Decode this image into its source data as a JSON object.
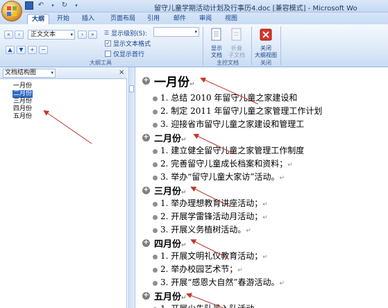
{
  "title": "留守儿童学期活动计划及行事历4.doc [兼容模式] - Microsoft Wo",
  "tabs": [
    {
      "label": "大纲",
      "active": true
    },
    {
      "label": "开始"
    },
    {
      "label": "插入"
    },
    {
      "label": "页面布局"
    },
    {
      "label": "引用"
    },
    {
      "label": "邮件"
    },
    {
      "label": "审阅"
    },
    {
      "label": "视图"
    }
  ],
  "ribbon": {
    "level_select": "正文文本",
    "show_level_label": "显示级别(S):",
    "show_text_format": "显示文本格式",
    "show_first_line": "仅显示首行",
    "outline_tools_label": "大纲工具",
    "show_document_label1": "显示",
    "show_document_label2": "文档",
    "collapse_sub_label1": "折叠",
    "collapse_sub_label2": "子文档",
    "master_doc_label": "主控文档",
    "close_label1": "关闭",
    "close_label2": "大纲视图",
    "close_group_label": "关闭"
  },
  "nav_panel": {
    "select": "文档结构图",
    "close": "×",
    "items": [
      "一月份",
      "二月份",
      "三月份",
      "四月份",
      "五月份"
    ],
    "selected_index": 1
  },
  "document": {
    "lines": [
      {
        "type": "heading",
        "text": "一月份"
      },
      {
        "type": "item",
        "text": "1. 总结 2010 年留守儿童之家建设和"
      },
      {
        "type": "item",
        "text": "2. 制定 2011 年留守儿童之家管理工作计划"
      },
      {
        "type": "item",
        "text": "3. 迎接省市留守儿童之家建设和管理工"
      },
      {
        "type": "heading",
        "text": "二月份"
      },
      {
        "type": "item",
        "text": "1. 建立健全留守儿童之家管理工作制度"
      },
      {
        "type": "item",
        "text": "2. 完善留守儿童成长档案和资料；"
      },
      {
        "type": "item",
        "text": "3. 举办“留守儿童大家访”活动。"
      },
      {
        "type": "heading",
        "text": "三月份"
      },
      {
        "type": "item",
        "text": "1. 举办理想教育讲座活动；"
      },
      {
        "type": "item",
        "text": "2. 开展学雷锋活动月活动；"
      },
      {
        "type": "item",
        "text": "3. 开展义务植树活动。"
      },
      {
        "type": "heading",
        "text": "四月份"
      },
      {
        "type": "item",
        "text": "1. 开展文明礼仪教育活动；"
      },
      {
        "type": "item",
        "text": "2. 举办校园艺术节；"
      },
      {
        "type": "item",
        "text": "3. 开展“感恩大自然”春游活动。"
      },
      {
        "type": "heading",
        "text": "五月份"
      },
      {
        "type": "item",
        "text": "1. 开展少先队员入队活动"
      }
    ],
    "para_mark": "↵"
  },
  "colors": {
    "accent": "#316ac5",
    "annotation_arrow": "#c0392b"
  }
}
